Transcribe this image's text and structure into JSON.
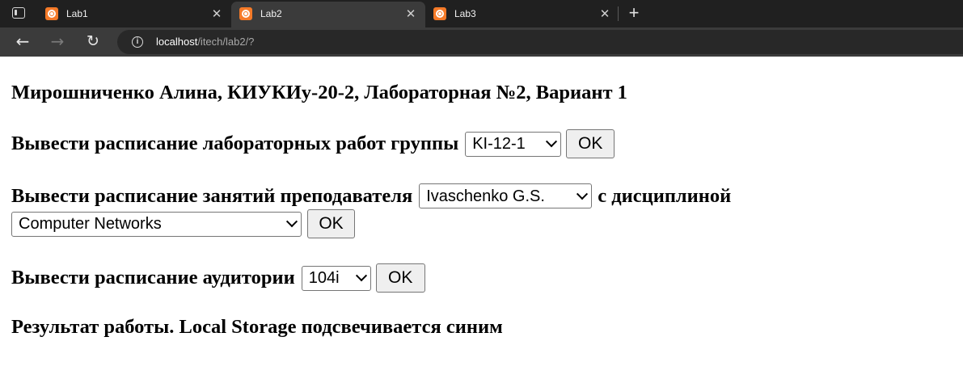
{
  "browser": {
    "tabs": [
      {
        "title": "Lab1",
        "close_glyph": "✕"
      },
      {
        "title": "Lab2",
        "close_glyph": "✕"
      },
      {
        "title": "Lab3",
        "close_glyph": "✕"
      }
    ],
    "new_tab_glyph": "+",
    "address": {
      "host": "localhost",
      "path": "/itech/lab2/?"
    },
    "icons": {
      "back": "←",
      "forward": "→",
      "reload": "↻",
      "info": "i"
    }
  },
  "page": {
    "header": "Мирошниченко Алина, КИУКИу-20-2, Лабораторная №2, Вариант 1",
    "group_form": {
      "label": "Вывести расписание лабораторных работ группы",
      "selected": "KI-12-1",
      "ok": "OK"
    },
    "teacher_form": {
      "label": "Вывести расписание занятий преподавателя",
      "selected_teacher": "Ivaschenko G.S.",
      "discipline_label": "с дисциплиной",
      "selected_discipline": "Computer Networks",
      "ok": "OK"
    },
    "room_form": {
      "label": "Вывести расписание аудитории",
      "selected": "104i",
      "ok": "OK"
    },
    "result_heading": "Результат работы. Local Storage подсвечивается синим"
  }
}
